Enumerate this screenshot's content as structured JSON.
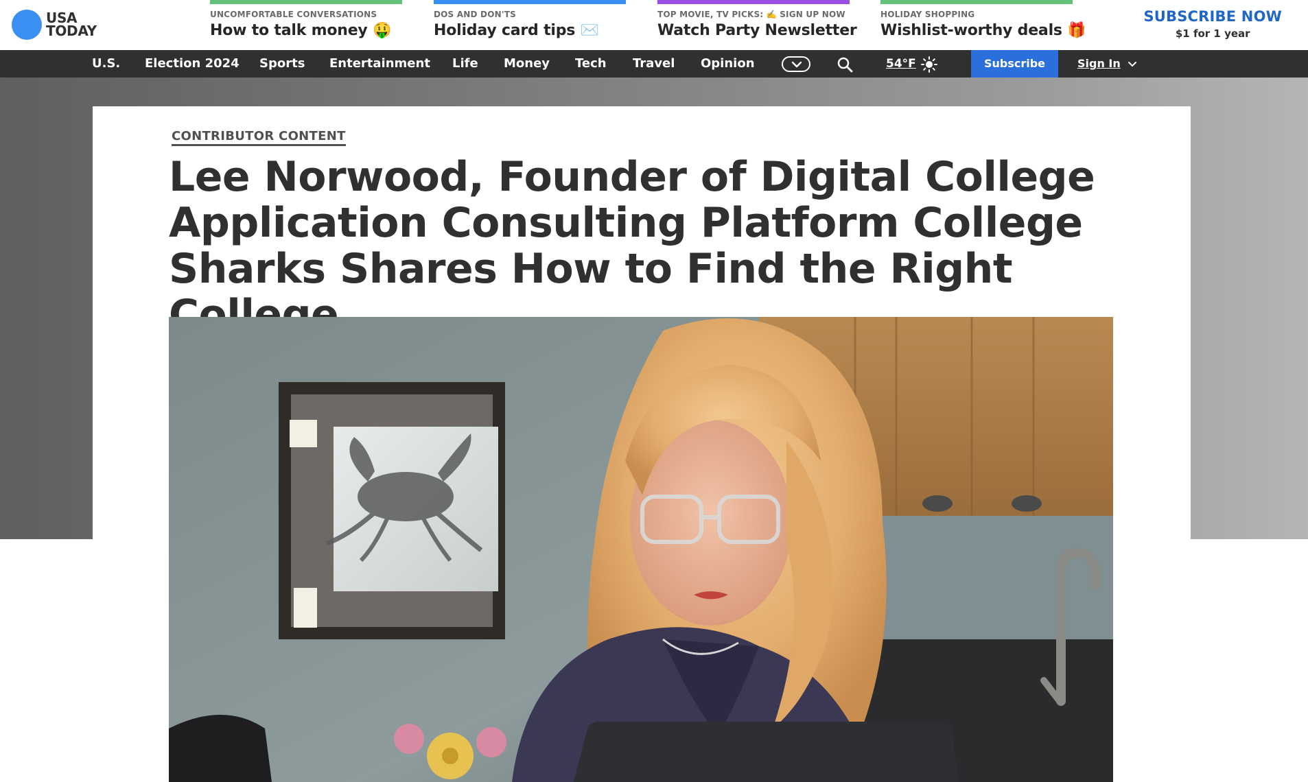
{
  "brand": {
    "line1": "USA",
    "line2": "TODAY",
    "accent": "#3b8ff3"
  },
  "promos": [
    {
      "kicker": "UNCOMFORTABLE CONVERSATIONS",
      "headline": "How to talk money 🤑",
      "color": "#63c17a"
    },
    {
      "kicker": "DOS AND DON'TS",
      "headline": "Holiday card tips ✉️",
      "color": "#3b8ff3"
    },
    {
      "kicker": "TOP MOVIE, TV PICKS: ✍️ SIGN UP NOW",
      "headline": "Watch Party Newsletter",
      "color": "#9b4ee3"
    },
    {
      "kicker": "HOLIDAY SHOPPING",
      "headline": "Wishlist-worthy deals 🎁",
      "color": "#63c17a"
    }
  ],
  "subscribe": {
    "cta": "SUBSCRIBE NOW",
    "price": "$1 for 1 year",
    "color": "#1f66c7"
  },
  "nav": {
    "items": [
      "U.S.",
      "Election 2024",
      "Sports",
      "Entertainment",
      "Life",
      "Money",
      "Tech",
      "Travel",
      "Opinion"
    ],
    "weather": "54°F",
    "subscribe": "Subscribe",
    "signin": "Sign In"
  },
  "article": {
    "label": "CONTRIBUTOR CONTENT",
    "title": "Lee Norwood, Founder of Digital College Application Consulting Platform College Sharks Shares How to Find the Right College"
  }
}
